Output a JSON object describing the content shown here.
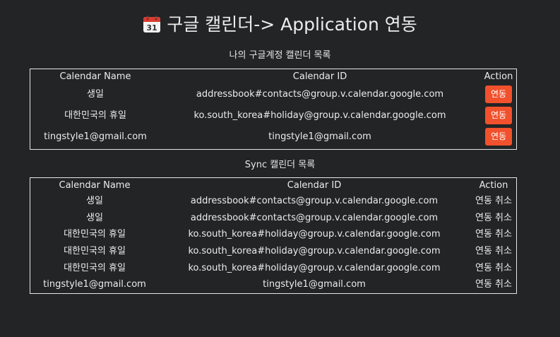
{
  "header": {
    "title": "구글 캘린더-> Application 연동",
    "icon": "calendar-icon",
    "icon_date": "31"
  },
  "my_calendars": {
    "caption": "나의 구글계정 캘린더 목록",
    "columns": [
      "Calendar Name",
      "Calendar ID",
      "Action"
    ],
    "action_label": "연동",
    "rows": [
      {
        "name": "생일",
        "id": "addressbook#contacts@group.v.calendar.google.com"
      },
      {
        "name": "대한민국의 휴일",
        "id": "ko.south_korea#holiday@group.v.calendar.google.com"
      },
      {
        "name": "tingstyle1@gmail.com",
        "id": "tingstyle1@gmail.com"
      }
    ]
  },
  "sync_calendars": {
    "caption": "Sync 캘린더 목록",
    "columns": [
      "Calendar Name",
      "Calendar ID",
      "Action"
    ],
    "action_label": "연동 취소",
    "rows": [
      {
        "name": "생일",
        "id": "addressbook#contacts@group.v.calendar.google.com"
      },
      {
        "name": "생일",
        "id": "addressbook#contacts@group.v.calendar.google.com"
      },
      {
        "name": "대한민국의 휴일",
        "id": "ko.south_korea#holiday@group.v.calendar.google.com"
      },
      {
        "name": "대한민국의 휴일",
        "id": "ko.south_korea#holiday@group.v.calendar.google.com"
      },
      {
        "name": "대한민국의 휴일",
        "id": "ko.south_korea#holiday@group.v.calendar.google.com"
      },
      {
        "name": "tingstyle1@gmail.com",
        "id": "tingstyle1@gmail.com"
      }
    ]
  },
  "colors": {
    "background": "#222425",
    "accent": "#f1512c",
    "border": "#e6e6e6"
  }
}
